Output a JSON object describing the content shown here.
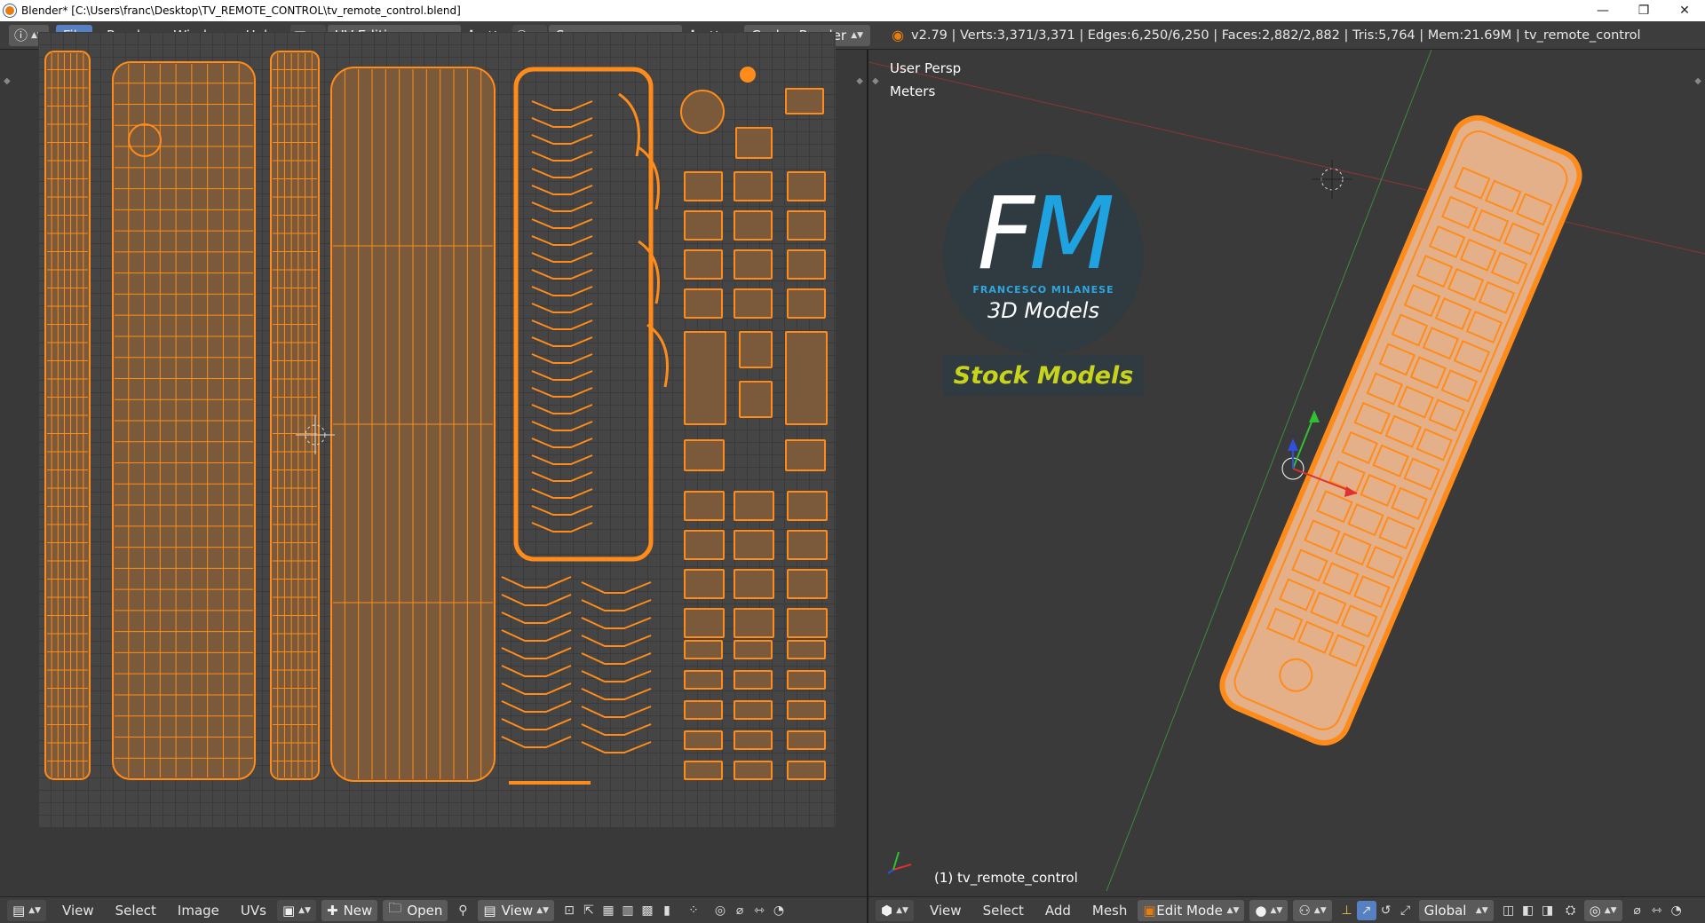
{
  "window": {
    "title": "Blender* [C:\\Users\\franc\\Desktop\\TV_REMOTE_CONTROL\\tv_remote_control.blend]",
    "minimize": "—",
    "maximize": "❐",
    "close": "✕"
  },
  "infobar": {
    "menus": [
      "File",
      "Render",
      "Window",
      "Help"
    ],
    "screen_layout": "UV Editing",
    "scene": "Scene",
    "render_engine": "Cycles Render",
    "stats": "v2.79 | Verts:3,371/3,371 | Edges:6,250/6,250 | Faces:2,882/2,882 | Tris:5,764 | Mem:21.69M | tv_remote_control"
  },
  "viewport": {
    "perspective": "User Persp",
    "units": "Meters",
    "object_label": "(1) tv_remote_control",
    "logo": {
      "initials_f": "F",
      "initials_m": "M",
      "name": "FRANCESCO MILANESE",
      "tagline": "3D Models",
      "banner": "Stock Models"
    }
  },
  "uv_header": {
    "menus": [
      "View",
      "Select",
      "Image",
      "UVs"
    ],
    "new_label": "New",
    "open_label": "Open",
    "view_label": "View"
  },
  "view3d_header": {
    "menus": [
      "View",
      "Select",
      "Add",
      "Mesh"
    ],
    "mode": "Edit Mode",
    "orientation": "Global"
  },
  "colors": {
    "uv_wire": "#ff8c1a",
    "uv_fill": "#7a5a3a",
    "accent": "#5680c2"
  }
}
